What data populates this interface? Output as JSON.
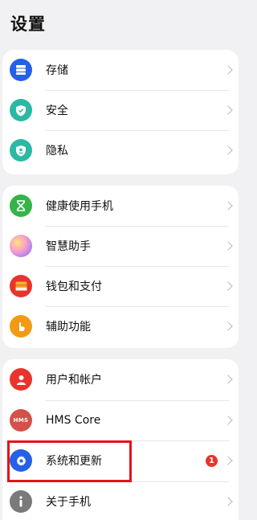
{
  "header": {
    "title": "设置"
  },
  "groups": [
    {
      "items": [
        {
          "label": "存储",
          "icon": "storage-icon",
          "color": "#2560e6"
        },
        {
          "label": "安全",
          "icon": "security-shield-icon",
          "color": "#2bb8a5"
        },
        {
          "label": "隐私",
          "icon": "privacy-icon",
          "color": "#2bb8a5"
        }
      ]
    },
    {
      "items": [
        {
          "label": "健康使用手机",
          "icon": "hourglass-icon",
          "color": "#34b449"
        },
        {
          "label": "智慧助手",
          "icon": "smart-assistant-icon",
          "color": "#d57ae0"
        },
        {
          "label": "钱包和支付",
          "icon": "wallet-icon",
          "color": "#e8342a"
        },
        {
          "label": "辅助功能",
          "icon": "accessibility-hand-icon",
          "color": "#f29a14"
        }
      ]
    },
    {
      "items": [
        {
          "label": "用户和帐户",
          "icon": "user-icon",
          "color": "#e8342a"
        },
        {
          "label": "HMS Core",
          "icon": "hms-core-icon",
          "color": "#d4504a",
          "icon_text": "HMS"
        },
        {
          "label": "系统和更新",
          "icon": "settings-gear-icon",
          "color": "#2560e6",
          "badge": "1"
        },
        {
          "label": "关于手机",
          "icon": "info-icon",
          "color": "#7a7a7a"
        }
      ]
    }
  ]
}
